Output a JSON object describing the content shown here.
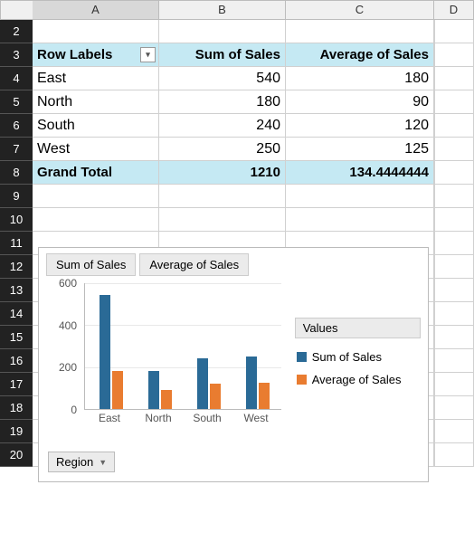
{
  "columns": [
    "A",
    "B",
    "C",
    "D"
  ],
  "rows": [
    "2",
    "3",
    "4",
    "5",
    "6",
    "7",
    "8",
    "9",
    "10",
    "11",
    "12",
    "13",
    "14",
    "15",
    "16",
    "17",
    "18",
    "19",
    "20"
  ],
  "pivot": {
    "row_label_header": "Row Labels",
    "col1": "Sum of Sales",
    "col2": "Average of Sales",
    "data": [
      {
        "label": "East",
        "sum": "540",
        "avg": "180"
      },
      {
        "label": "North",
        "sum": "180",
        "avg": "90"
      },
      {
        "label": "South",
        "sum": "240",
        "avg": "120"
      },
      {
        "label": "West",
        "sum": "250",
        "avg": "125"
      }
    ],
    "total_label": "Grand Total",
    "total_sum": "1210",
    "total_avg": "134.4444444"
  },
  "chart_buttons": {
    "btn1": "Sum of Sales",
    "btn2": "Average of Sales"
  },
  "legend": {
    "title": "Values",
    "s1": "Sum of Sales",
    "s2": "Average of Sales"
  },
  "region_filter": "Region",
  "chart_data": {
    "type": "bar",
    "categories": [
      "East",
      "North",
      "South",
      "West"
    ],
    "series": [
      {
        "name": "Sum of Sales",
        "values": [
          540,
          180,
          240,
          250
        ],
        "color": "#2a6a96"
      },
      {
        "name": "Average of Sales",
        "values": [
          180,
          90,
          120,
          125
        ],
        "color": "#e97c30"
      }
    ],
    "ylim": [
      0,
      600
    ],
    "y_ticks": [
      0,
      200,
      400,
      600
    ],
    "xlabel": "",
    "ylabel": "",
    "title": ""
  }
}
